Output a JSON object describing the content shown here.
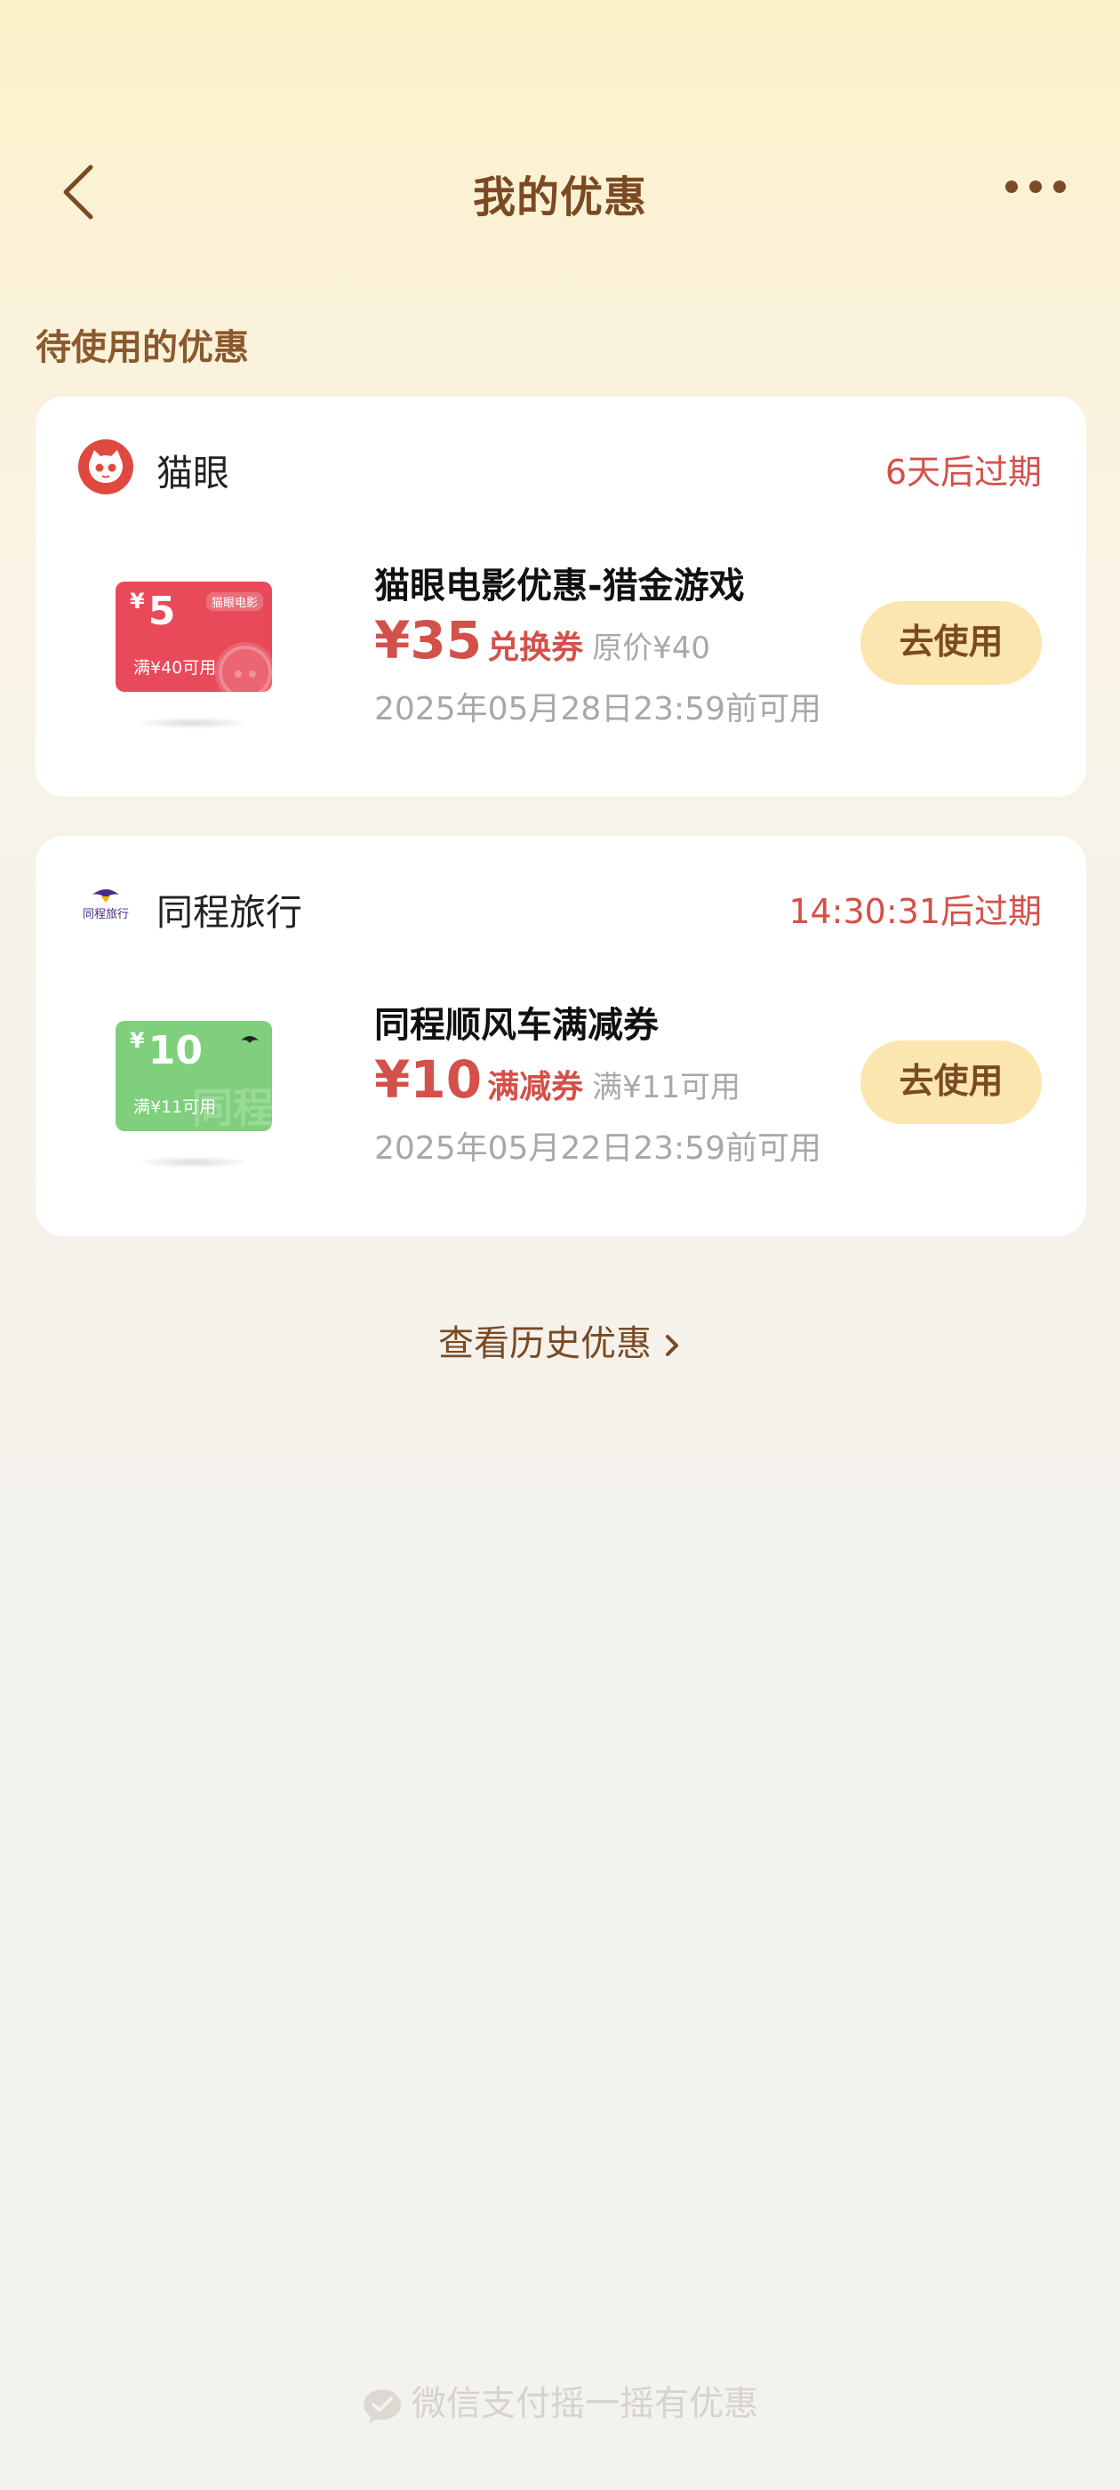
{
  "header": {
    "title": "我的优惠"
  },
  "section": {
    "title": "待使用的优惠"
  },
  "coupons": [
    {
      "brand": "猫眼",
      "expire": "6天后过期",
      "title": "猫眼电影优惠-猎金游戏",
      "amount": "¥35",
      "type": "兑换券",
      "original": "原价¥40",
      "valid_until": "2025年05月28日23:59前可用",
      "button": "去使用",
      "image": {
        "amount": "5",
        "currency": "¥",
        "condition": "满¥40可用",
        "color": "#e84a5a",
        "brand_tag": "猫眼电影"
      }
    },
    {
      "brand": "同程旅行",
      "expire": "14:30:31后过期",
      "title": "同程顺风车满减券",
      "amount": "¥10",
      "type": "满减券",
      "original": "满¥11可用",
      "valid_until": "2025年05月22日23:59前可用",
      "button": "去使用",
      "image": {
        "amount": "10",
        "currency": "¥",
        "condition": "满¥11可用",
        "color": "#7fcf7c",
        "brand_tag": "同程"
      }
    }
  ],
  "history_link": "查看历史优惠",
  "footer": "微信支付摇一摇有优惠",
  "colors": {
    "accent_red": "#d4504a",
    "brown": "#7a4a22",
    "button_bg": "#fae6ae"
  }
}
